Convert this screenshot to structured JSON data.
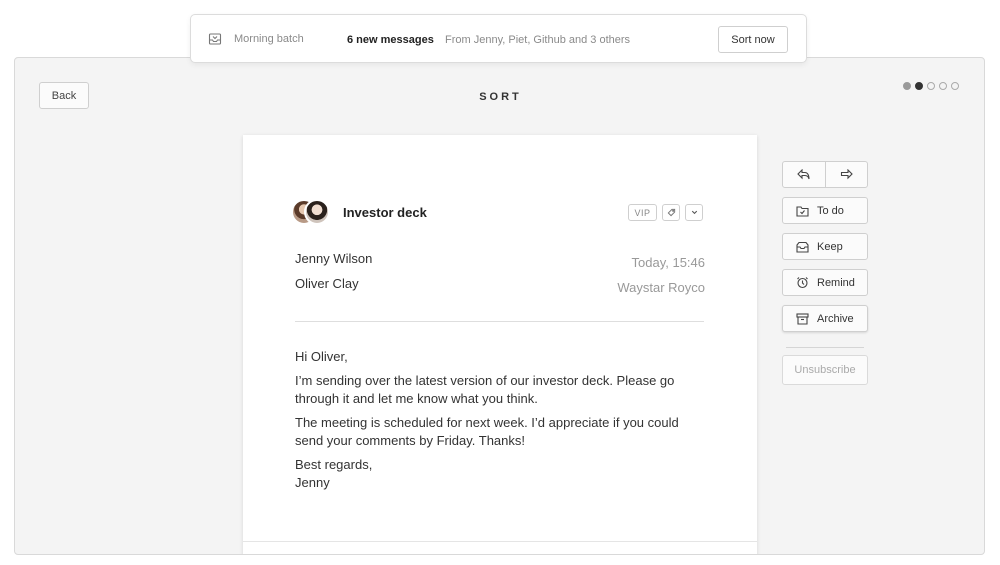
{
  "notification": {
    "icon": "inbox-tray-icon",
    "batch_label": "Morning batch",
    "count_label": "6 new messages",
    "from_label": "From Jenny, Piet, Github and 3 others",
    "sort_button": "Sort now"
  },
  "header": {
    "back_label": "Back",
    "title": "SORT",
    "pagination": {
      "total": 5,
      "current": 2
    }
  },
  "email": {
    "subject": "Investor deck",
    "tags": {
      "vip": "VIP",
      "tag_icon": "tag-icon",
      "more_icon": "chevron-down-icon"
    },
    "sender": "Jenny Wilson",
    "recipient": "Oliver Clay",
    "time": "Today, 15:46",
    "company": "Waystar Royco",
    "greeting": "Hi Oliver,",
    "para1": "I’m sending over the latest version of our investor deck. Please go through it and let me know what you think.",
    "para2": "The meeting is scheduled for next week. I’d appreciate if you could send your comments by Friday. Thanks!",
    "signoff1": "Best regards,",
    "signoff2": "Jenny"
  },
  "actions": {
    "reply_icon": "reply-icon",
    "forward_icon": "forward-icon",
    "todo": "To do",
    "keep": "Keep",
    "remind": "Remind",
    "archive": "Archive",
    "unsubscribe": "Unsubscribe"
  }
}
